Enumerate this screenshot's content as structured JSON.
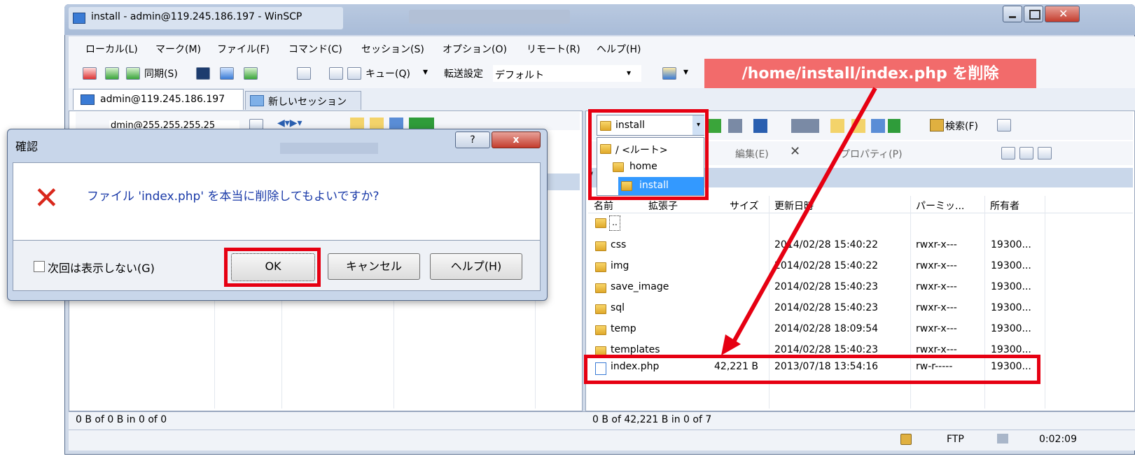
{
  "window": {
    "title": "install - admin@119.245.186.197 - WinSCP",
    "menu": [
      "ローカル(L)",
      "マーク(M)",
      "ファイル(F)",
      "コマンド(C)",
      "セッション(S)",
      "オプション(O)",
      "リモート(R)",
      "ヘルプ(H)"
    ],
    "toolbar": {
      "sync_label": "同期(S)",
      "queue_label": "キュー(Q)",
      "transfer_settings_label": "転送設定",
      "transfer_settings_value": "デフォルト"
    },
    "tabs": [
      "admin@119.245.186.197",
      "新しいセッション"
    ],
    "hidden_session_label": "dmin@255.255.255.25"
  },
  "remote": {
    "path_dropdown": {
      "selected": "install",
      "options": [
        "/ <ルート>",
        "home",
        "install"
      ]
    },
    "toolbar": {
      "search_label": "検索(F)",
      "edit_label": "編集(E)",
      "properties_label": "プロパティ(P)"
    },
    "path_fragment": "/",
    "columns": {
      "name": "名前",
      "ext": "拡張子",
      "size": "サイズ",
      "modified": "更新日時",
      "perms": "パーミッ...",
      "owner": "所有者"
    },
    "parent_label": "..",
    "rows": [
      {
        "name": "css",
        "size": "",
        "modified": "2014/02/28 15:40:22",
        "perms": "rwxr-x---",
        "owner": "19300..."
      },
      {
        "name": "img",
        "size": "",
        "modified": "2014/02/28 15:40:22",
        "perms": "rwxr-x---",
        "owner": "19300..."
      },
      {
        "name": "save_image",
        "size": "",
        "modified": "2014/02/28 15:40:23",
        "perms": "rwxr-x---",
        "owner": "19300..."
      },
      {
        "name": "sql",
        "size": "",
        "modified": "2014/02/28 15:40:23",
        "perms": "rwxr-x---",
        "owner": "19300..."
      },
      {
        "name": "temp",
        "size": "",
        "modified": "2014/02/28 18:09:54",
        "perms": "rwxr-x---",
        "owner": "19300..."
      },
      {
        "name": "templates",
        "size": "",
        "modified": "2014/02/28 15:40:23",
        "perms": "rwxr-x---",
        "owner": "19300..."
      },
      {
        "name": "index.php",
        "size": "42,221 B",
        "modified": "2013/07/18 13:54:16",
        "perms": "rw-r-----",
        "owner": "19300..."
      }
    ]
  },
  "status": {
    "left": "0 B of 0 B in 0 of 0",
    "right": "0 B of 42,221 B in 0 of 7",
    "protocol": "FTP",
    "elapsed": "0:02:09"
  },
  "dialog": {
    "title": "確認",
    "message": "ファイル 'index.php' を本当に削除してもよいですか?",
    "checkbox_label": "次回は表示しない(G)",
    "ok_label": "OK",
    "cancel_label": "キャンセル",
    "help_label": "ヘルプ(H)",
    "help_button_glyph": "?",
    "close_glyph": "x"
  },
  "annotation": {
    "text": "/home/install/index.php を削除",
    "color": "#e60012"
  }
}
